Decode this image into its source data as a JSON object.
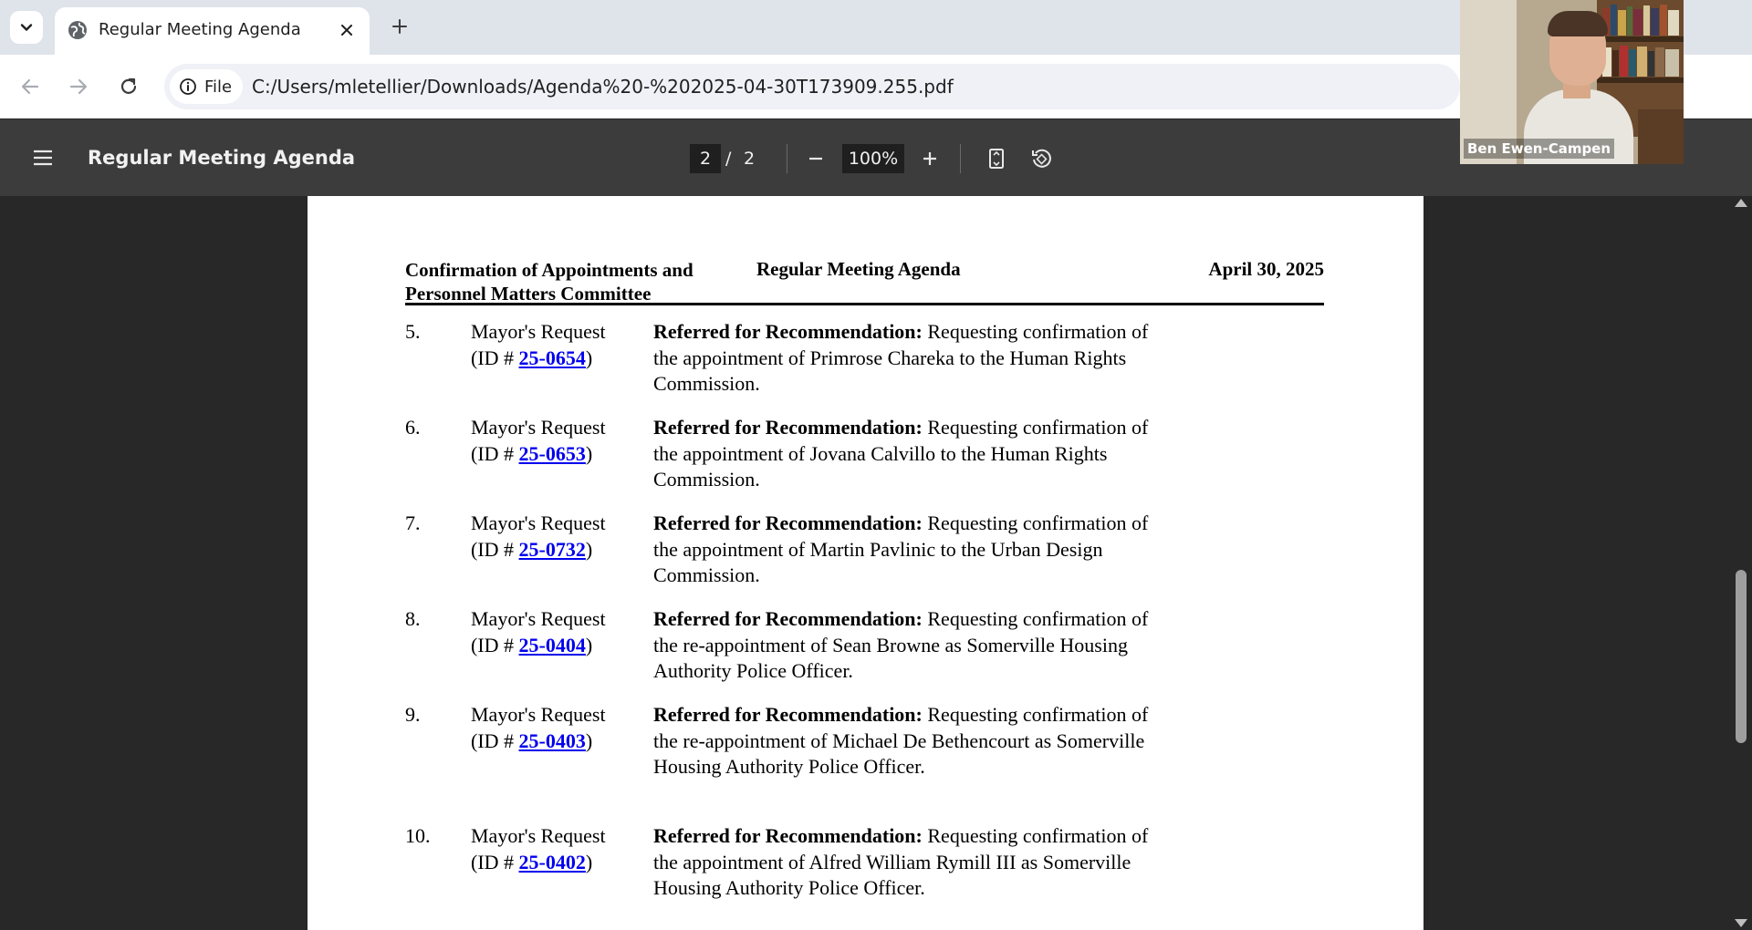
{
  "browser": {
    "tab": {
      "title": "Regular Meeting Agenda"
    },
    "address": {
      "scheme_label": "File",
      "url": "C:/Users/mletellier/Downloads/Agenda%20-%202025-04-30T173909.255.pdf"
    }
  },
  "pdf_toolbar": {
    "title": "Regular Meeting Agenda",
    "current_page": "2",
    "page_separator": "/",
    "total_pages": "2",
    "zoom": "100%"
  },
  "document": {
    "header": {
      "committee_line1": "Confirmation of Appointments and",
      "committee_line2": "Personnel Matters Committee",
      "center": "Regular Meeting Agenda",
      "date": "April 30, 2025"
    },
    "items": [
      {
        "num": "5.",
        "request": "Mayor's Request",
        "id_prefix": "(ID # ",
        "id": "25-0654",
        "id_suffix": ")",
        "lead": "Referred for Recommendation:",
        "text": " Requesting confirmation of the appointment of Primrose Chareka to the Human Rights Commission."
      },
      {
        "num": "6.",
        "request": "Mayor's Request",
        "id_prefix": "(ID # ",
        "id": "25-0653",
        "id_suffix": ")",
        "lead": "Referred for Recommendation:",
        "text": " Requesting confirmation of the appointment of Jovana Calvillo to the Human Rights Commission."
      },
      {
        "num": "7.",
        "request": "Mayor's Request",
        "id_prefix": "(ID # ",
        "id": "25-0732",
        "id_suffix": ")",
        "lead": "Referred for Recommendation:",
        "text": " Requesting confirmation of the appointment of Martin Pavlinic to the Urban Design Commission."
      },
      {
        "num": "8.",
        "request": "Mayor's Request",
        "id_prefix": "(ID # ",
        "id": "25-0404",
        "id_suffix": ")",
        "lead": "Referred for Recommendation:",
        "text": " Requesting confirmation of the re-appointment of Sean Browne as Somerville Housing Authority Police Officer."
      },
      {
        "num": "9.",
        "request": "Mayor's Request",
        "id_prefix": "(ID # ",
        "id": "25-0403",
        "id_suffix": ")",
        "lead": "Referred for Recommendation:",
        "text": " Requesting confirmation of the re-appointment of Michael De Bethencourt as Somerville Housing Authority Police Officer."
      },
      {
        "num": "10.",
        "request": "Mayor's Request",
        "id_prefix": "(ID # ",
        "id": "25-0402",
        "id_suffix": ")",
        "lead": "Referred for Recommendation:",
        "text": " Requesting confirmation of the appointment of Alfred William Rymill III as Somerville Housing Authority Police Officer."
      }
    ]
  },
  "video_overlay": {
    "participant_name": "Ben Ewen-Campen"
  },
  "colors": {
    "link": "#0000ee",
    "pdf_toolbar_bg": "#3c3c3c",
    "viewer_bg": "#282828",
    "tabstrip_bg": "#dfe3ea"
  },
  "icons": {
    "tab_search": "chevron-down-icon",
    "favicon": "globe-icon",
    "tab_close": "close-icon",
    "new_tab": "plus-icon",
    "back": "arrow-left-icon",
    "forward": "arrow-right-icon",
    "reload": "reload-icon",
    "site_info": "info-icon",
    "menu": "hamburger-icon",
    "zoom_out": "minus-icon",
    "zoom_in": "plus-icon",
    "fit": "fit-page-icon",
    "rotate": "rotate-icon"
  }
}
